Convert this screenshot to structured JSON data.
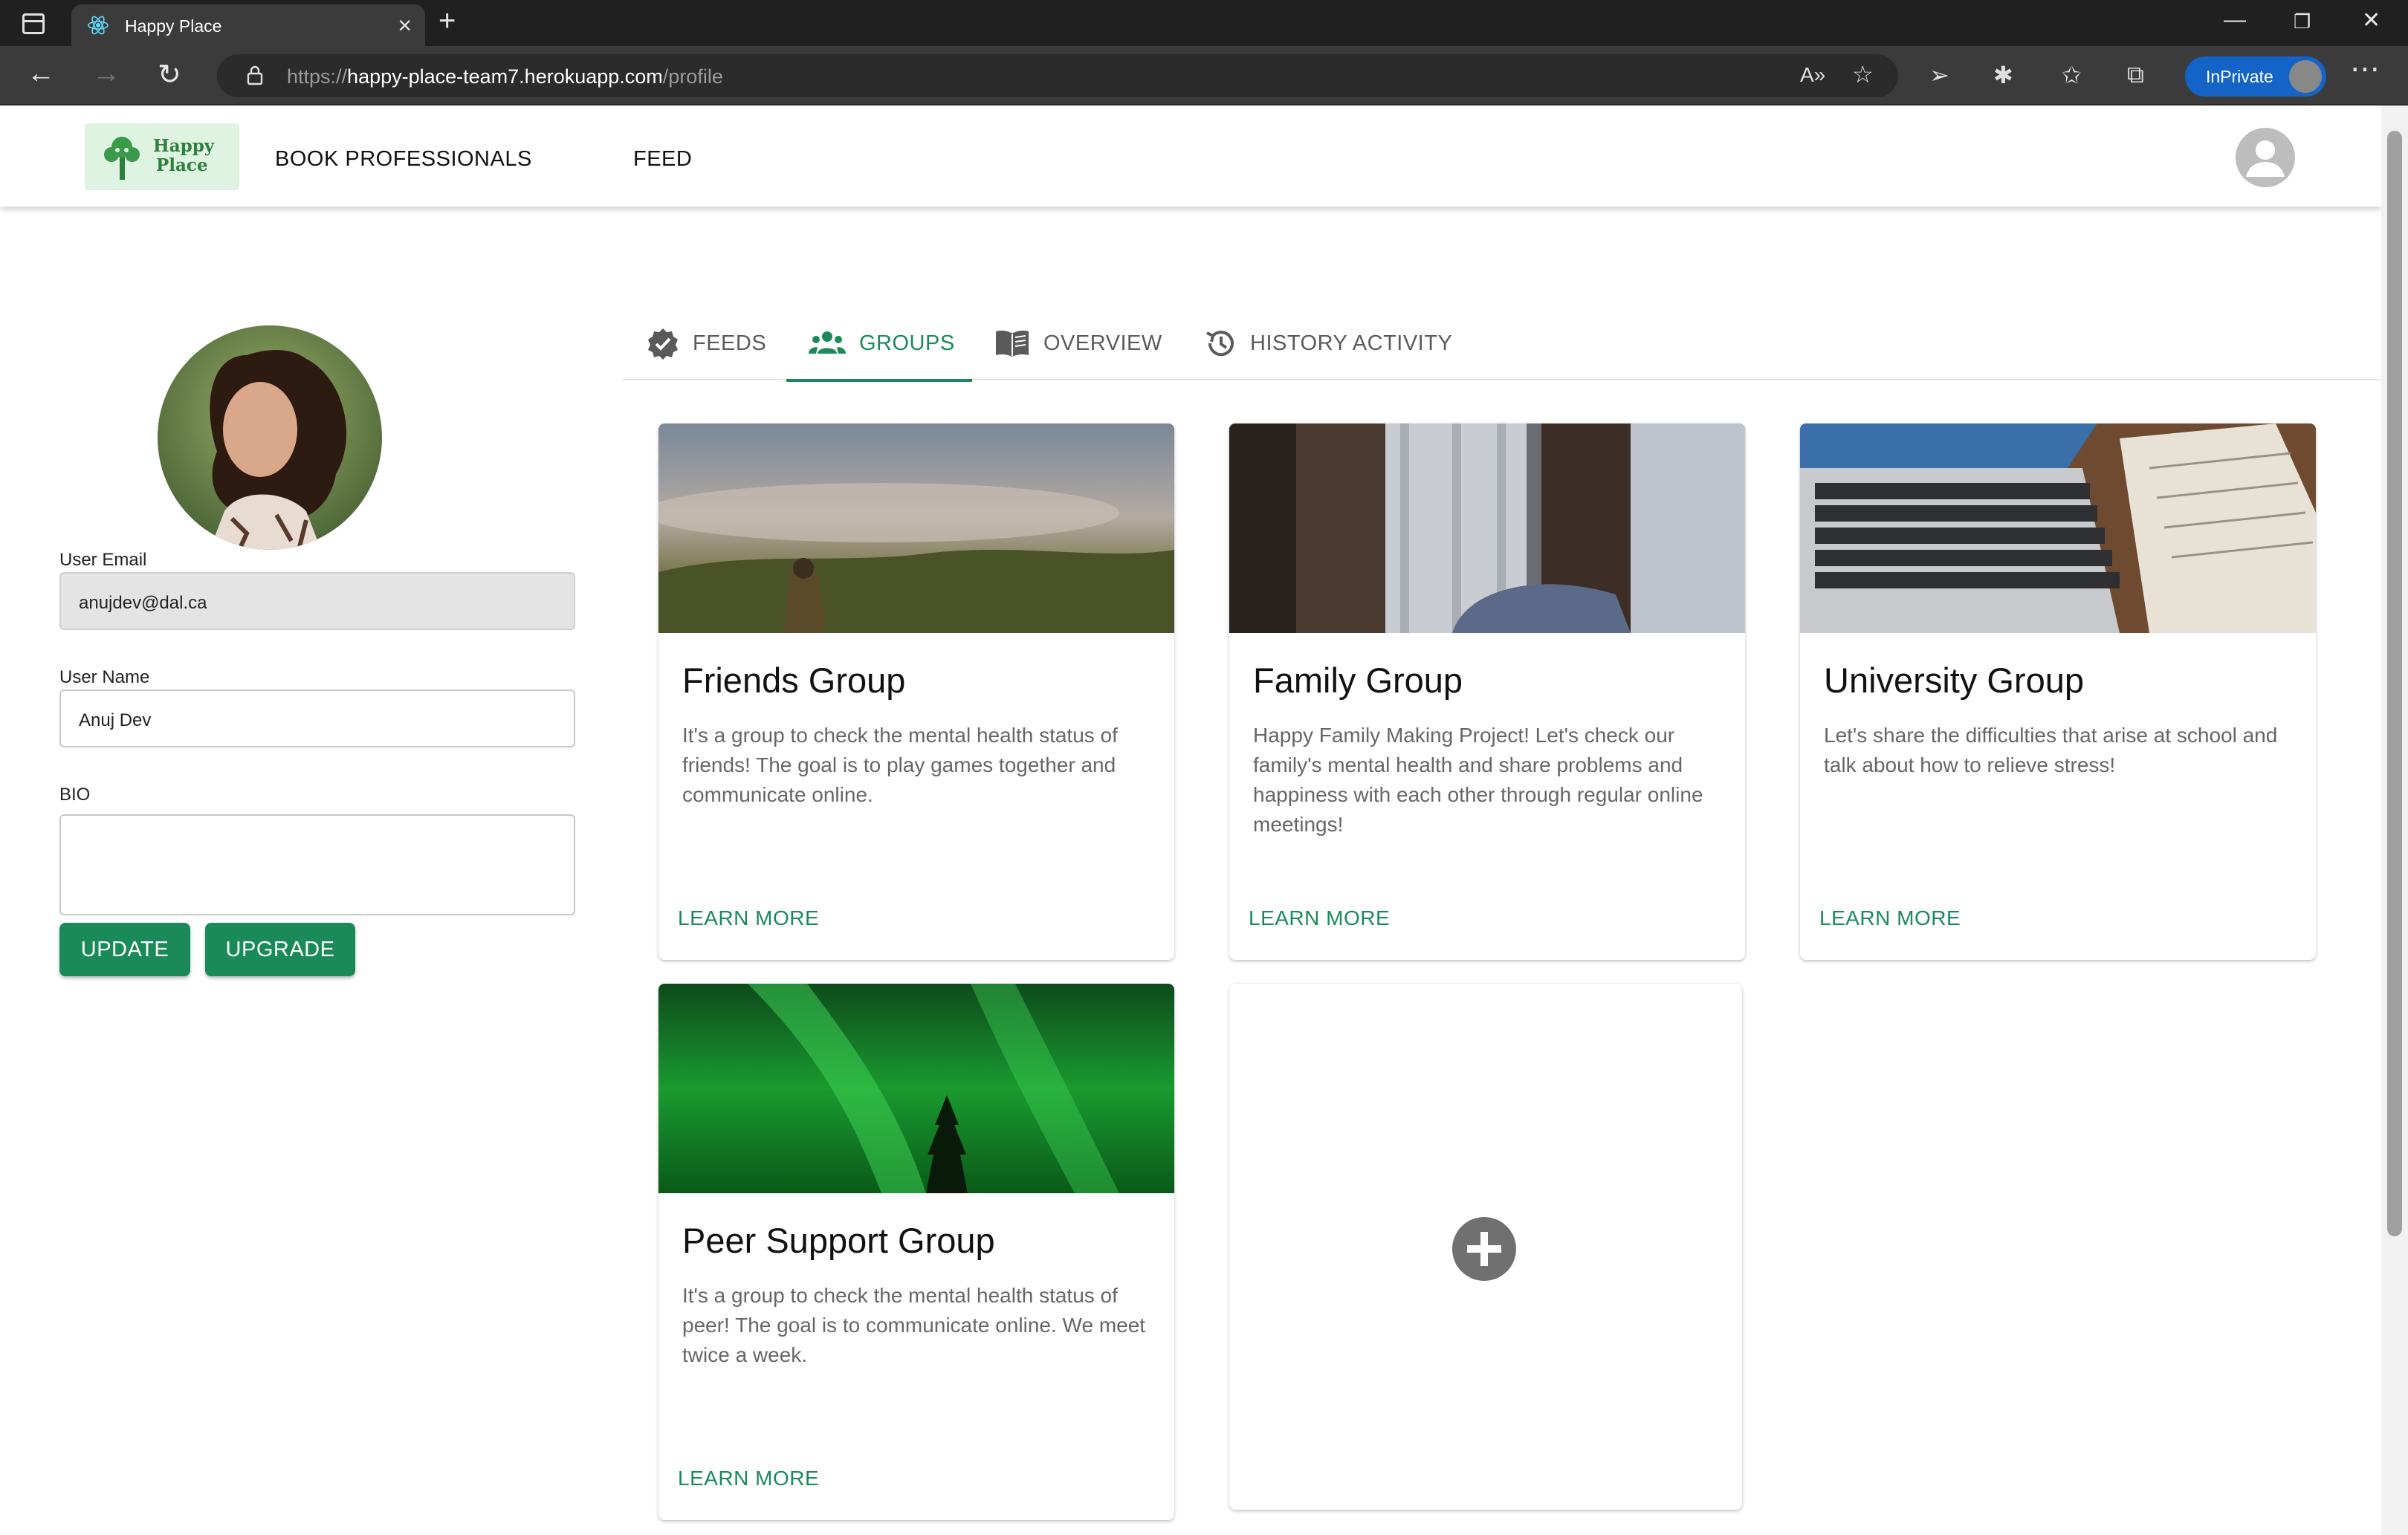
{
  "browser": {
    "tab_title": "Happy Place",
    "url_scheme": "https://",
    "url_host": "happy-place-team7.herokuapp.com",
    "url_path": "/profile",
    "inprivate_label": "InPrivate"
  },
  "appbar": {
    "logo_line1": "Happy",
    "logo_line2": "Place",
    "nav_book": "BOOK PROFESSIONALS",
    "nav_feed": "FEED"
  },
  "profile": {
    "email_label": "User Email",
    "email_value": "anujdev@dal.ca",
    "name_label": "User Name",
    "name_value": "Anuj Dev",
    "bio_label": "BIO",
    "bio_value": "",
    "update_label": "UPDATE",
    "upgrade_label": "UPGRADE"
  },
  "tabs": [
    {
      "label": "FEEDS",
      "icon": "verified-badge-icon",
      "active": false
    },
    {
      "label": "GROUPS",
      "icon": "groups-icon",
      "active": true
    },
    {
      "label": "OVERVIEW",
      "icon": "book-icon",
      "active": false
    },
    {
      "label": "HISTORY ACTIVITY",
      "icon": "history-icon",
      "active": false
    }
  ],
  "groups": [
    {
      "title": "Friends Group",
      "description": "It's a group to check the mental health status of friends! The goal is to play games together and communicate online.",
      "action": "LEARN MORE"
    },
    {
      "title": "Family Group",
      "description": "Happy Family Making Project! Let's check our family's mental health and share problems and happiness with each other through regular online meetings!",
      "action": "LEARN MORE"
    },
    {
      "title": "University Group",
      "description": "Let's share the difficulties that arise at school and talk about how to relieve stress!",
      "action": "LEARN MORE"
    },
    {
      "title": "Peer Support Group",
      "description": "It's a group to check the mental health status of peer! The goal is to communicate online. We meet twice a week.",
      "action": "LEARN MORE"
    }
  ],
  "colors": {
    "accent": "#1a8a5a",
    "chrome_dark": "#202020",
    "inprivate_blue": "#1464c8"
  }
}
